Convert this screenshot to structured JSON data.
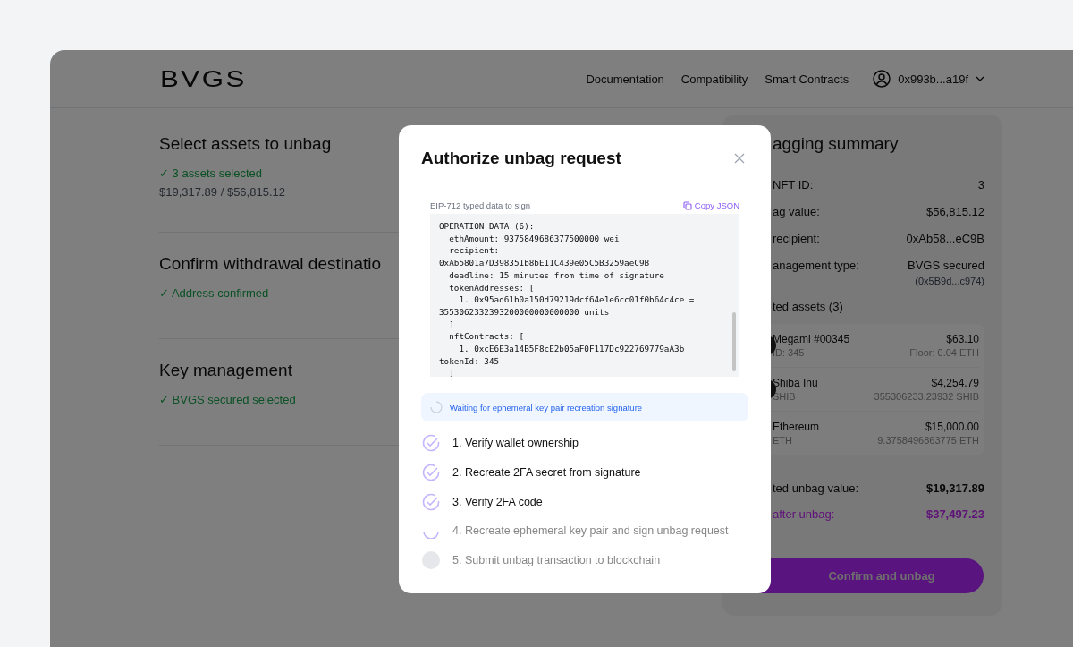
{
  "header": {
    "logo": "BVGS",
    "nav": [
      "Documentation",
      "Compatibility",
      "Smart Contracts"
    ],
    "account": "0x993b...a19f"
  },
  "sections": [
    {
      "title": "Select assets to unbag",
      "status": "✓ 3 assets selected",
      "detail": "$19,317.89 / $56,815.12"
    },
    {
      "title": "Confirm withdrawal destinatio",
      "status": "✓ Address confirmed"
    },
    {
      "title": "Key management",
      "status": "✓ BVGS secured selected"
    }
  ],
  "summary": {
    "title": "agging summary",
    "rows": [
      {
        "label": "NFT ID:",
        "value": "3"
      },
      {
        "label": "ag value:",
        "value": "$56,815.12"
      },
      {
        "label": "recipient:",
        "value": "0xAb58...eC9B"
      },
      {
        "label": "anagement type:",
        "value": "BVGS secured",
        "note": "(0x5B9d...c974)"
      }
    ],
    "assets_label": "ted assets (3)",
    "assets": [
      {
        "name": "Megami #00345",
        "value": "$63.10",
        "sub": "ID: 345",
        "amount": "Floor: 0.04 ETH",
        "icon": true
      },
      {
        "name": "Shiba Inu",
        "value": "$4,254.79",
        "sub": "SHIB",
        "amount": "355306233.23932 SHIB",
        "icon": true
      },
      {
        "name": "Ethereum",
        "value": "$15,000.00",
        "sub": "ETH",
        "amount": "9.3758496863775 ETH",
        "icon": false
      }
    ],
    "totals": [
      {
        "label": "ted unbag value:",
        "value": "$19,317.89",
        "highlight": false
      },
      {
        "label": "after unbag:",
        "value": "$37,497.23",
        "highlight": true
      }
    ],
    "button": "Confirm and unbag"
  },
  "modal": {
    "title": "Authorize unbag request",
    "data_label": "EIP-712 typed data to sign",
    "copy": "Copy JSON",
    "code": [
      "OPERATION DATA (6):",
      "  ethAmount: 9375849686377500000 wei",
      "  recipient:",
      "0xAb5801a7D398351b8bE11C439e05C5B3259aeC9B",
      "  deadline: 15 minutes from time of signature",
      "  tokenAddresses: [",
      "    1. 0x95ad61b0a150d79219dcf64e1e6cc01f0b64c4ce =",
      "3553062332393200000000000000 units",
      "  ]",
      "  nftContracts: [",
      "    1. 0xcE6E3a14B5F8cE2b05aF0F117Dc922769779aA3b",
      "tokenId: 345",
      "  ]"
    ],
    "waiting": "Waiting for ephemeral key pair recreation signature",
    "steps": [
      {
        "label": "1. Verify wallet ownership",
        "kind": "done"
      },
      {
        "label": "2. Recreate 2FA secret from signature",
        "kind": "done"
      },
      {
        "label": "3. Verify 2FA code",
        "kind": "done"
      },
      {
        "label": "4. Recreate ephemeral key pair and sign unbag request",
        "kind": "active"
      },
      {
        "label": "5. Submit unbag transaction to blockchain",
        "kind": "pending"
      }
    ]
  }
}
